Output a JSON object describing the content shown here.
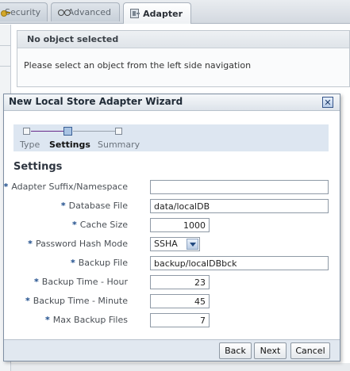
{
  "tabs": [
    {
      "label": "Security",
      "icon": "key-icon"
    },
    {
      "label": "Advanced",
      "icon": "glasses-icon"
    },
    {
      "label": "Adapter",
      "icon": "adapter-icon",
      "active": true
    }
  ],
  "content": {
    "header": "No object selected",
    "message": "Please select an object from the left side navigation"
  },
  "dialog": {
    "title": "New Local Store Adapter Wizard",
    "close_icon": "close-icon",
    "train": {
      "steps": [
        "Type",
        "Settings",
        "Summary"
      ],
      "current": "Settings"
    },
    "section_title": "Settings",
    "required_mark": "*",
    "fields": {
      "adapter_suffix": {
        "label": "Adapter Suffix/Namespace",
        "value": ""
      },
      "database_file": {
        "label": "Database File",
        "value": "data/localDB"
      },
      "cache_size": {
        "label": "Cache Size",
        "value": "1000"
      },
      "password_hash_mode": {
        "label": "Password Hash Mode",
        "value": "SSHA"
      },
      "backup_file": {
        "label": "Backup File",
        "value": "backup/localDBbck"
      },
      "backup_hour": {
        "label": "Backup Time - Hour",
        "value": "23"
      },
      "backup_minute": {
        "label": "Backup Time - Minute",
        "value": "45"
      },
      "max_backup_files": {
        "label": "Max Backup Files",
        "value": "7"
      }
    },
    "buttons": {
      "back": "Back",
      "next": "Next",
      "cancel": "Cancel"
    }
  },
  "colors": {
    "train_done": "#6a2a8a",
    "train_pending": "#9aa3ad",
    "required": "#1a4a8a",
    "footer": "#e1e8f0"
  }
}
